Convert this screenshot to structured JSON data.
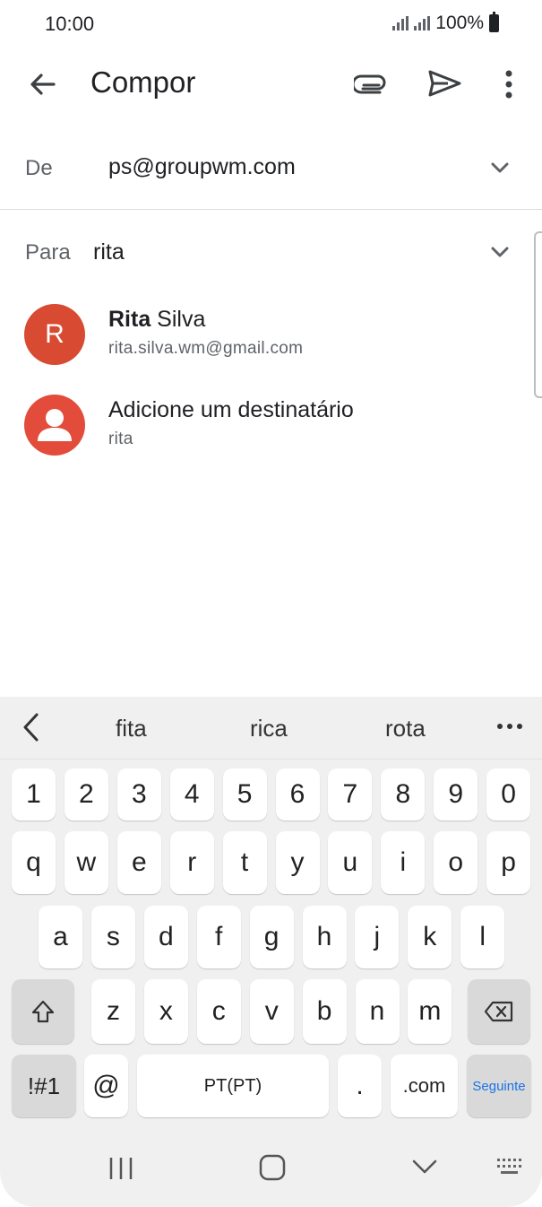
{
  "status_bar": {
    "time": "10:00",
    "battery_text": "100%"
  },
  "app_bar": {
    "title": "Compor",
    "back_icon": "arrow-back-icon",
    "attach_icon": "paperclip-icon",
    "send_icon": "send-icon",
    "more_icon": "more-vertical-icon"
  },
  "from": {
    "label": "De",
    "value": "ps@groupwm.com"
  },
  "to": {
    "label": "Para",
    "value": "rita"
  },
  "suggestions": [
    {
      "avatar_letter": "R",
      "name_bold": "Rita",
      "name_rest": " Silva",
      "subtitle": "rita.silva.wm@gmail.com",
      "avatar_color": "#d84a31"
    },
    {
      "avatar_icon": "person-icon",
      "name": "Adicione um destinatário",
      "subtitle": "rita",
      "avatar_color": "#e34b3b"
    }
  ],
  "keyboard": {
    "word_suggestions": [
      "fita",
      "rica",
      "rota"
    ],
    "row_numbers": [
      "1",
      "2",
      "3",
      "4",
      "5",
      "6",
      "7",
      "8",
      "9",
      "0"
    ],
    "row_top": [
      "q",
      "w",
      "e",
      "r",
      "t",
      "y",
      "u",
      "i",
      "o",
      "p"
    ],
    "row_middle": [
      "a",
      "s",
      "d",
      "f",
      "g",
      "h",
      "j",
      "k",
      "l"
    ],
    "row_bottom": [
      "z",
      "x",
      "c",
      "v",
      "b",
      "n",
      "m"
    ],
    "symbols_label": "!#1",
    "at_label": "@",
    "space_label": "PT(PT)",
    "dot_label": ".",
    "com_label": ".com",
    "action_label": "Seguinte",
    "accent_color": "#1a73e8"
  }
}
